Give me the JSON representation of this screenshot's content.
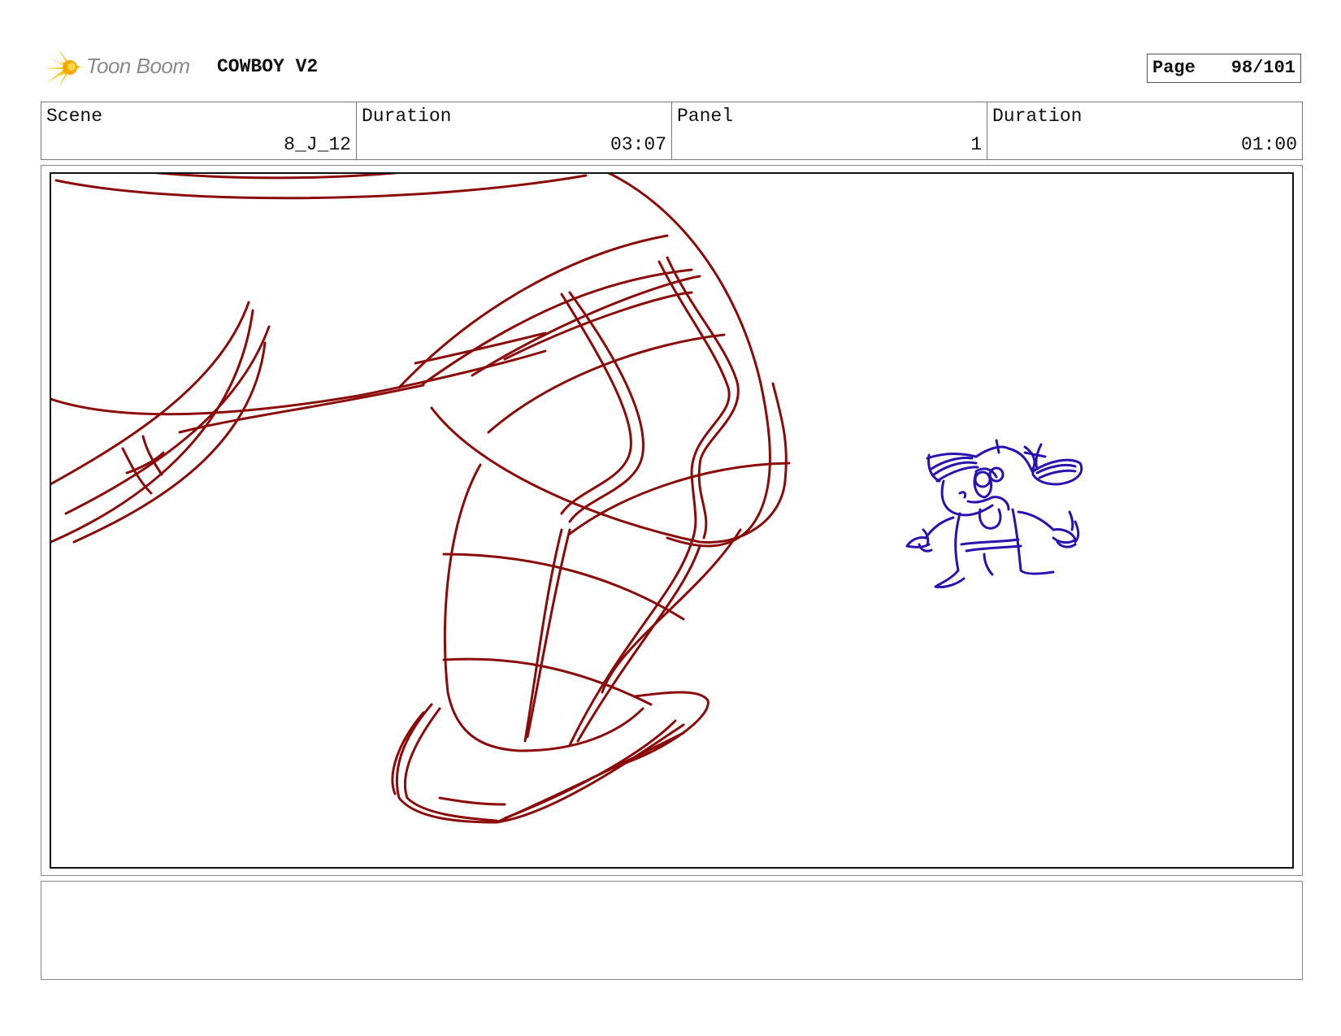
{
  "header": {
    "logo_text": "Toon Boom",
    "project_title": "COWBOY V2",
    "page_label": "Page",
    "page_number": "98/101"
  },
  "info": {
    "scene_label": "Scene",
    "scene_value": "8_J_12",
    "scene_duration_label": "Duration",
    "scene_duration_value": "03:07",
    "panel_label": "Panel",
    "panel_value": "1",
    "panel_duration_label": "Duration",
    "panel_duration_value": "01:00"
  },
  "colors": {
    "sketch_red": "#8b0a0a",
    "sketch_blue": "#2a12b0",
    "logo_yellow": "#f5c400"
  },
  "notes": {
    "text": ""
  }
}
